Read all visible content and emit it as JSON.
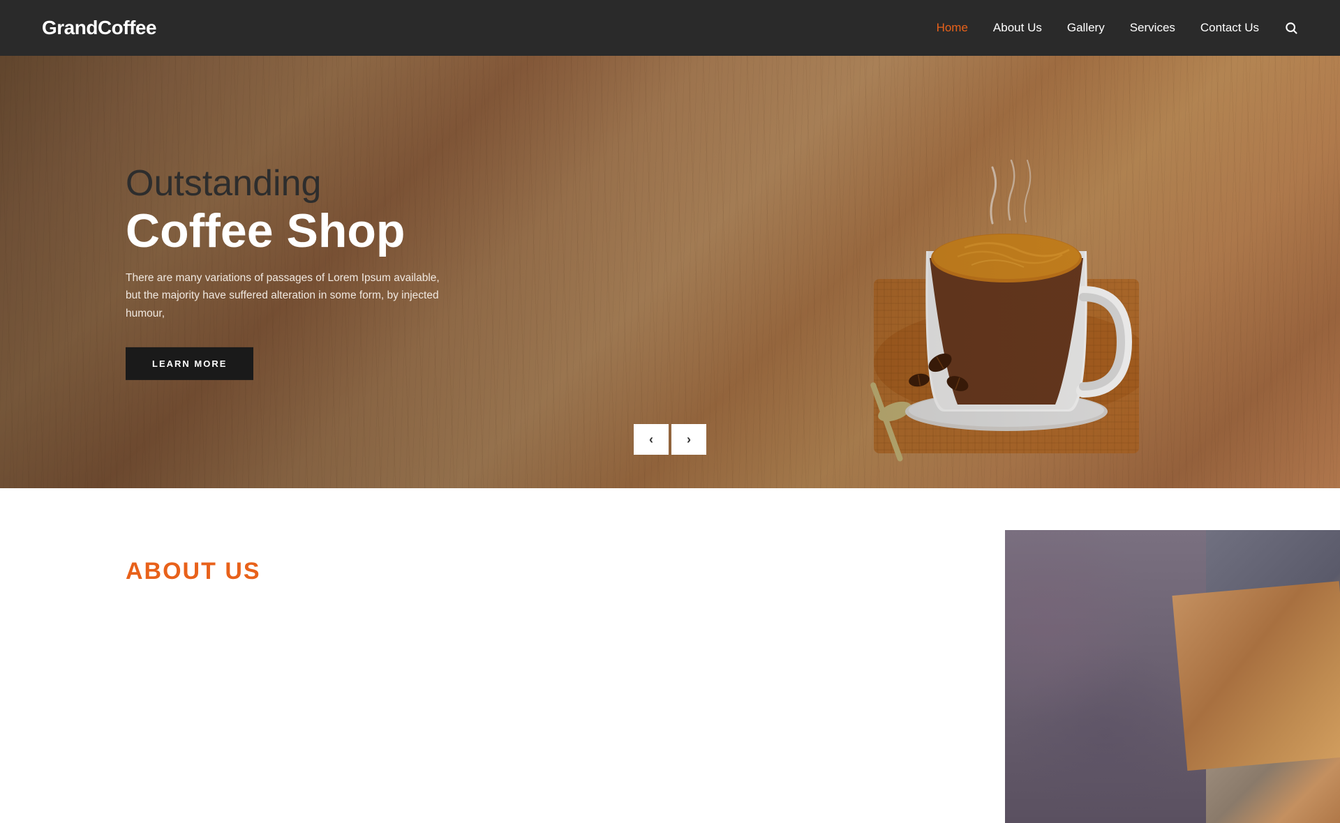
{
  "navbar": {
    "logo": "GrandCoffee",
    "nav_items": [
      {
        "label": "Home",
        "active": true
      },
      {
        "label": "About Us",
        "active": false
      },
      {
        "label": "Gallery",
        "active": false
      },
      {
        "label": "Services",
        "active": false
      },
      {
        "label": "Contact Us",
        "active": false
      }
    ],
    "search_label": "search"
  },
  "hero": {
    "subtitle": "Outstanding",
    "title": "Coffee Shop",
    "description": "There are many variations of passages of Lorem Ipsum available, but the majority have suffered alteration in some form, by injected humour,",
    "button_label": "LEARN MORE",
    "arrow_prev": "‹",
    "arrow_next": "›"
  },
  "about": {
    "label": "ABOUT US"
  }
}
